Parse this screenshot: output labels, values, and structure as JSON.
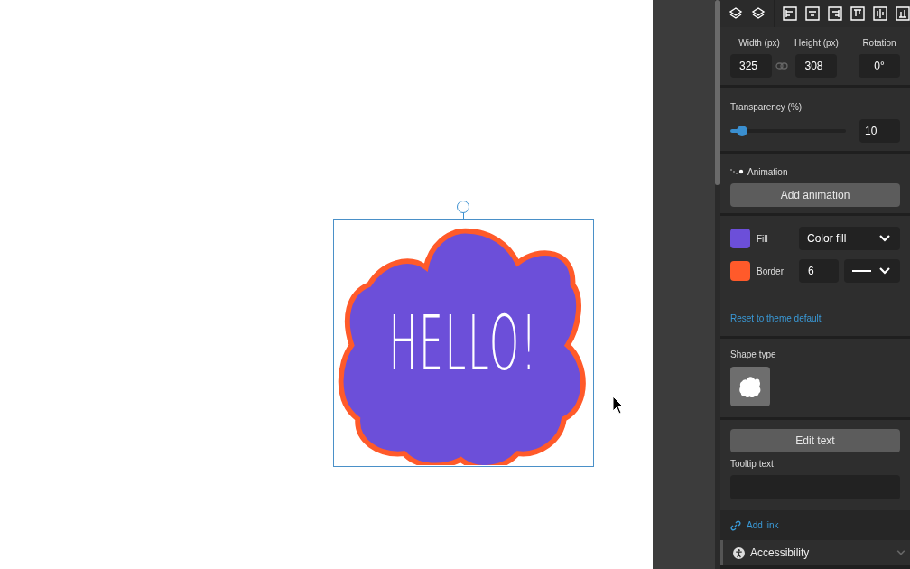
{
  "canvas": {
    "shape_text": "HELLO!"
  },
  "size_fields": [
    {
      "label": "Width (px)",
      "value": "325"
    },
    {
      "label": "Height (px)",
      "value": "308"
    },
    {
      "label": "Rotation",
      "value": "0°"
    }
  ],
  "transparency": {
    "label": "Transparency (%)",
    "level": 0.1,
    "value": "10"
  },
  "animation": {
    "label": "Animation",
    "button": "Add animation"
  },
  "style_rows": [
    {
      "kind": "fill",
      "label": "Fill",
      "color": "#6c4fd9",
      "value": "Color fill"
    },
    {
      "kind": "border",
      "label": "Border",
      "color": "#ff5a2a",
      "value": "6"
    }
  ],
  "reset_link": "Reset to theme default",
  "shape_type": {
    "label": "Shape type"
  },
  "edit_text_button": "Edit text",
  "tooltip": {
    "label": "Tooltip text"
  },
  "add_link": "Add link",
  "accessibility": {
    "label": "Accessibility",
    "expanded": false
  }
}
